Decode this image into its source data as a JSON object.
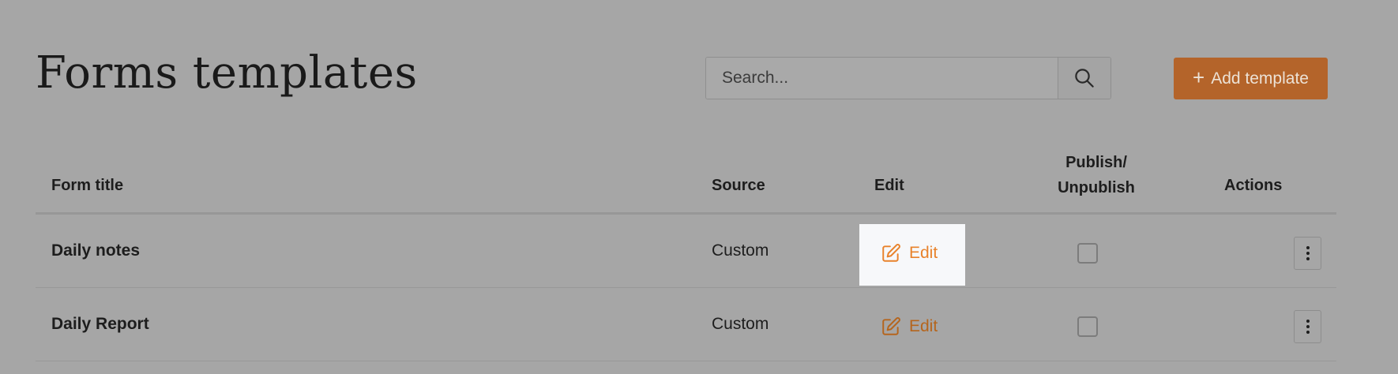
{
  "header": {
    "title": "Forms templates",
    "search_placeholder": "Search...",
    "add_button_label": "Add template"
  },
  "table": {
    "columns": {
      "title": "Form title",
      "source": "Source",
      "edit": "Edit",
      "publish_line1": "Publish/",
      "publish_line2": "Unpublish",
      "actions": "Actions"
    },
    "rows": [
      {
        "title": "Daily notes",
        "source": "Custom",
        "edit_label": "Edit",
        "published": false
      },
      {
        "title": "Daily Report",
        "source": "Custom",
        "edit_label": "Edit",
        "published": false
      }
    ]
  },
  "colors": {
    "accent": "#b4642a",
    "link": "#b5651d",
    "link_highlighted": "#e8822b",
    "overlay_background": "#a6a6a6"
  },
  "icons": {
    "search": "search-icon",
    "add": "plus-icon",
    "edit": "edit-icon",
    "more": "kebab-icon"
  }
}
